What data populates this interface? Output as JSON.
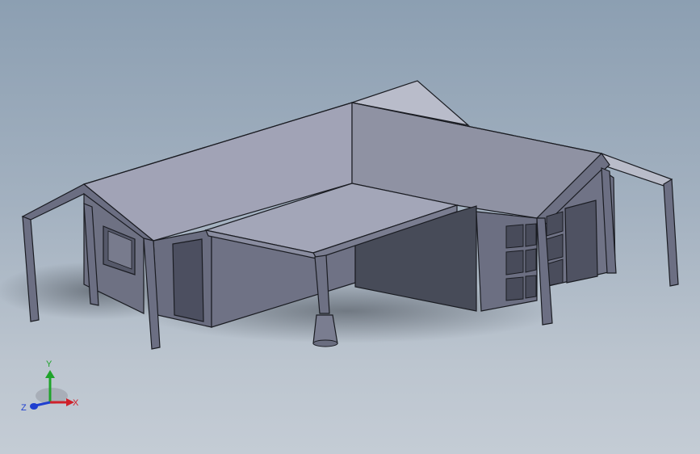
{
  "view": {
    "background_top": "#8c9fb2",
    "background_bottom": "#c4ccd5",
    "model_subject": "house-model"
  },
  "triad": {
    "x_label": "X",
    "y_label": "Y",
    "z_label": "Z",
    "x_color": "#d0202a",
    "y_color": "#1fa32b",
    "z_color": "#1f3fd0"
  }
}
